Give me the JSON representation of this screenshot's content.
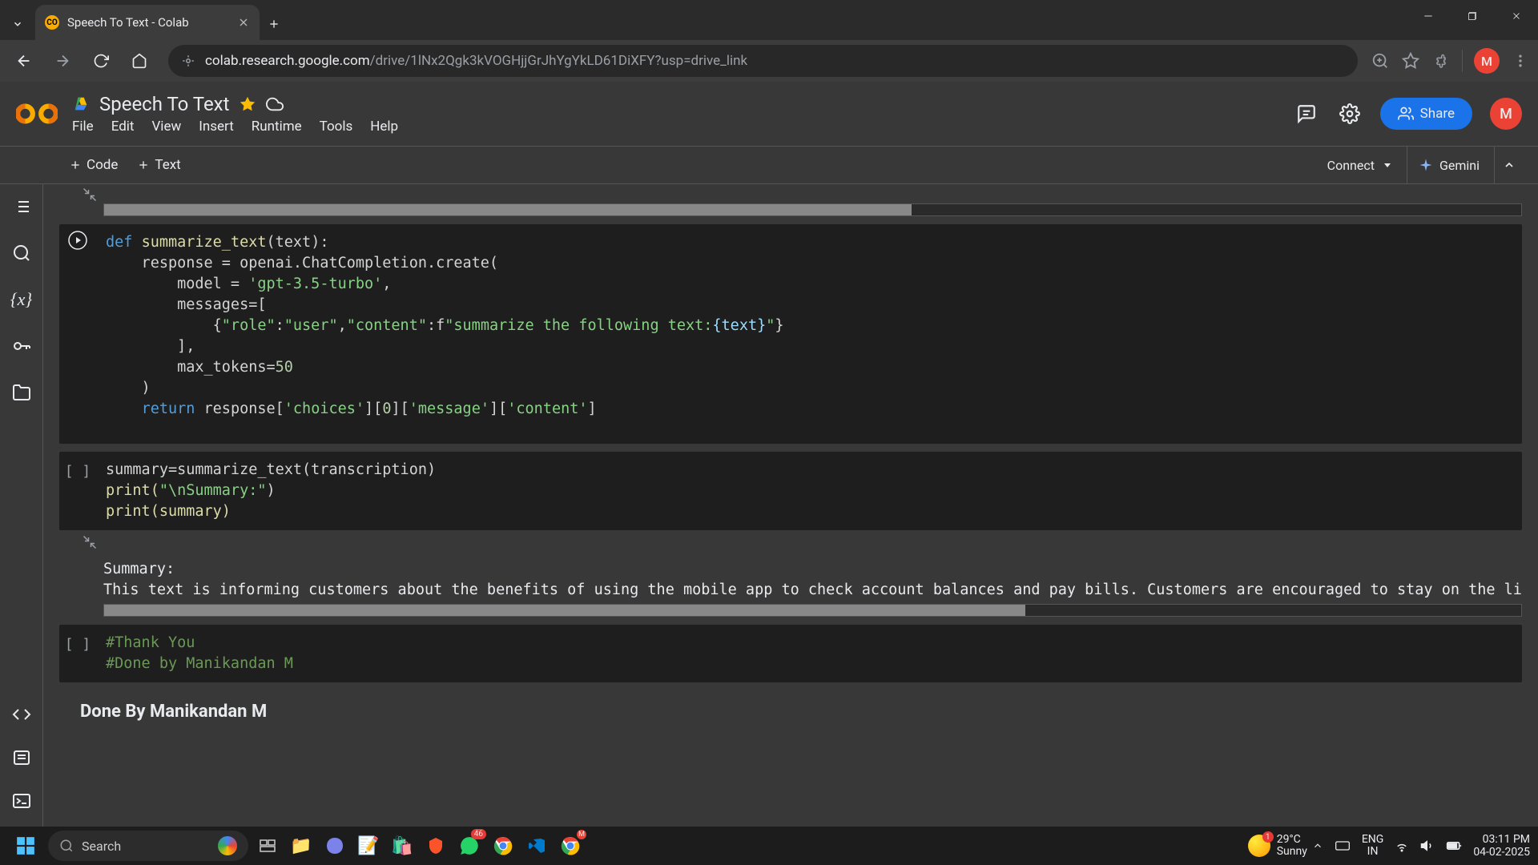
{
  "browser": {
    "tab_title": "Speech To Text - Colab",
    "tab_favicon_text": "CO",
    "url_display_domain": "colab.research.google.com",
    "url_display_path": "/drive/1lNx2Qgk3kVOGHjjGrJhYgYkLD61DiXFY?usp=drive_link"
  },
  "colab": {
    "title": "Speech To Text",
    "menu": [
      "File",
      "Edit",
      "View",
      "Insert",
      "Runtime",
      "Tools",
      "Help"
    ],
    "share_label": "Share",
    "avatar_letter": "M",
    "toolbar": {
      "code_label": "Code",
      "text_label": "Text",
      "connect_label": "Connect",
      "gemini_label": "Gemini"
    }
  },
  "cells": {
    "cell1": {
      "line1_def": "def",
      "line1_fn": "summarize_text",
      "line1_rest": "(text):",
      "line2": "    response = openai.ChatCompletion.create(",
      "line3a": "        model = ",
      "line3b": "'gpt-3.5-turbo'",
      "line3c": ",",
      "line4": "        messages=[",
      "line5a": "            {",
      "line5b": "\"role\"",
      "line5c": ":",
      "line5d": "\"user\"",
      "line5e": ",",
      "line5f": "\"content\"",
      "line5g": ":f",
      "line5h": "\"summarize the following text:",
      "line5i": "{text}",
      "line5j": "\"",
      "line5k": "}",
      "line6": "        ],",
      "line7a": "        max_tokens=",
      "line7b": "50",
      "line8": "    )",
      "line9a": "    ",
      "line9b": "return",
      "line9c": " response[",
      "line9d": "'choices'",
      "line9e": "][",
      "line9f": "0",
      "line9g": "][",
      "line9h": "'message'",
      "line9i": "][",
      "line9j": "'content'",
      "line9k": "]"
    },
    "cell2": {
      "exec": "[ ]",
      "line1": "summary=summarize_text(transcription)",
      "line2a": "print(",
      "line2b": "\"\\nSummary:\"",
      "line2c": ")",
      "line3": "print(summary)"
    },
    "output2": {
      "line1": "Summary:",
      "line2": "This text is informing customers about the benefits of using the mobile app to check account balances and pay bills. Customers are encouraged to stay on the line if t"
    },
    "cell3": {
      "exec": "[ ]",
      "line1": "#Thank You",
      "line2": "#Done by Manikandan M"
    },
    "markdown1": "Done By Manikandan M"
  },
  "taskbar": {
    "search_placeholder": "Search",
    "whatsapp_badge": "46",
    "weather_temp": "29°C",
    "weather_desc": "Sunny",
    "weather_alert": "1",
    "lang_top": "ENG",
    "lang_bottom": "IN",
    "time": "03:11 PM",
    "date": "04-02-2025"
  }
}
